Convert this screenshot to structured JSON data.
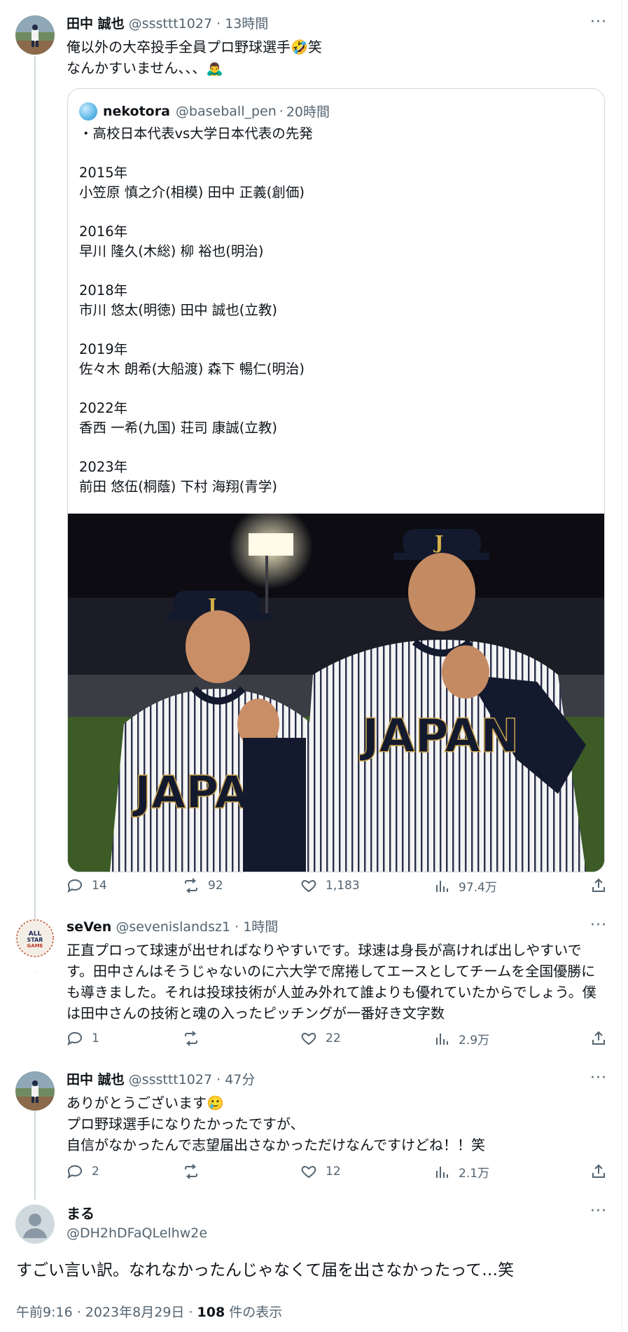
{
  "posts": [
    {
      "name": "田中 誠也",
      "handle": "@sssttt1027",
      "sep": "·",
      "time": "13時間",
      "text": "俺以外の大卒投手全員プロ野球選手🤣笑\nなんかすいません、、、🙇‍♂️",
      "stats": {
        "replies": "14",
        "reposts": "92",
        "likes": "1,183",
        "views": "97.4万"
      }
    },
    {
      "name": "seVen",
      "handle": "@sevenislandsz1",
      "sep": "·",
      "time": "1時間",
      "text": "正直プロって球速が出せればなりやすいです。球速は身長が高ければ出しやすいです。田中さんはそうじゃないのに六大学で席捲してエースとしてチームを全国優勝にも導きました。それは投球技術が人並み外れて誰よりも優れていたからでしょう。僕は田中さんの技術と魂の入ったピッチングが一番好き文字数",
      "stats": {
        "replies": "1",
        "reposts": "",
        "likes": "22",
        "views": "2.9万"
      }
    },
    {
      "name": "田中 誠也",
      "handle": "@sssttt1027",
      "sep": "·",
      "time": "47分",
      "text": "ありがとうございます🥲\nプロ野球選手になりたかったですが、\n自信がなかったんで志望届出さなかっただけなんですけどね！！笑",
      "stats": {
        "replies": "2",
        "reposts": "",
        "likes": "12",
        "views": "2.1万"
      }
    }
  ],
  "quote": {
    "name": "nekotora",
    "handle": "@baseball_pen",
    "sep": "·",
    "time": "20時間",
    "text": "・高校日本代表vs大学日本代表の先発\n\n2015年\n小笠原 慎之介(相模) 田中 正義(創価)\n\n2016年\n早川 隆久(木総) 柳 裕也(明治)\n\n2018年\n市川 悠太(明徳) 田中 誠也(立教)\n\n2019年\n佐々木 朗希(大船渡) 森下 暢仁(明治)\n\n2022年\n香西 一希(九国) 荘司 康誠(立教)\n\n2023年\n前田 悠伍(桐蔭) 下村 海翔(青学)",
    "photo_jersey_text": "JAPAN",
    "photo_cap_letter": "J"
  },
  "main": {
    "name": "まる",
    "handle": "@DH2hDFaQLelhw2e",
    "text": "すごい言い訳。なれなかったんじゃなくて届を出さなかったって…笑",
    "timestamp": "午前9:16 · 2023年8月29日 · ",
    "views_count": "108",
    "views_suffix": " 件の表示"
  },
  "more_label": "···",
  "colors": {
    "text": "#0f1419",
    "secondary": "#536471",
    "border": "#cfd9de"
  }
}
